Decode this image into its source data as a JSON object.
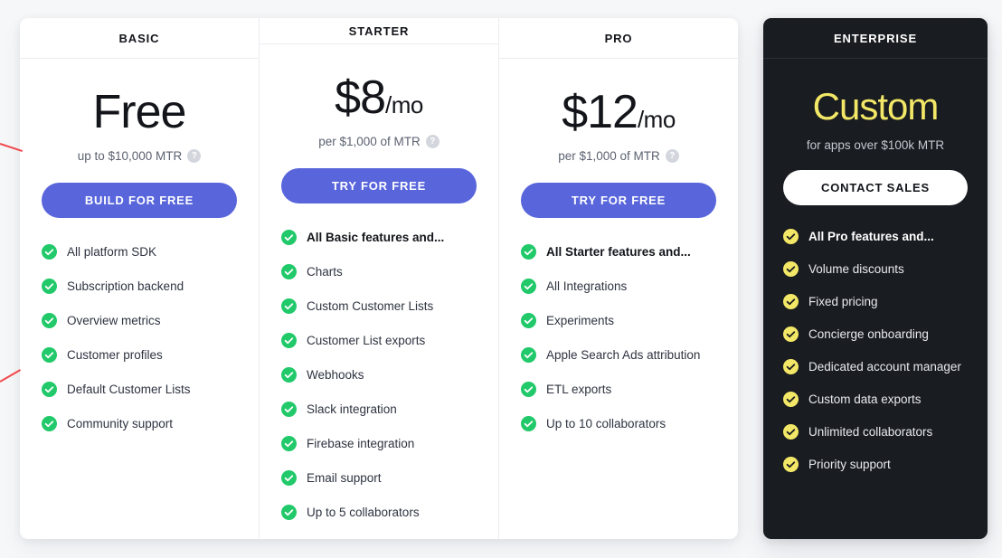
{
  "plans": [
    {
      "name": "BASIC",
      "price_main": "Free",
      "price_suffix": "",
      "price_note": "up to $10,000 MTR",
      "help_icon": "question-mark-icon",
      "help_label": "?",
      "cta_label": "BUILD FOR FREE",
      "theme": "light",
      "accent_color": "#5865db",
      "check_color": "#21c96a",
      "features": [
        {
          "label": "All platform SDK",
          "lead": false
        },
        {
          "label": "Subscription backend",
          "lead": false
        },
        {
          "label": "Overview metrics",
          "lead": false
        },
        {
          "label": "Customer profiles",
          "lead": false
        },
        {
          "label": "Default Customer Lists",
          "lead": false
        },
        {
          "label": "Community support",
          "lead": false
        }
      ]
    },
    {
      "name": "STARTER",
      "price_main": "$8",
      "price_suffix": "/mo",
      "price_note": "per $1,000 of MTR",
      "help_icon": "question-mark-icon",
      "help_label": "?",
      "cta_label": "TRY FOR FREE",
      "theme": "light",
      "accent_color": "#5865db",
      "check_color": "#21c96a",
      "features": [
        {
          "label": "All Basic features and...",
          "lead": true
        },
        {
          "label": "Charts",
          "lead": false
        },
        {
          "label": "Custom Customer Lists",
          "lead": false
        },
        {
          "label": "Customer List exports",
          "lead": false
        },
        {
          "label": "Webhooks",
          "lead": false
        },
        {
          "label": "Slack integration",
          "lead": false
        },
        {
          "label": "Firebase integration",
          "lead": false
        },
        {
          "label": "Email support",
          "lead": false
        },
        {
          "label": "Up to 5 collaborators",
          "lead": false
        }
      ]
    },
    {
      "name": "PRO",
      "price_main": "$12",
      "price_suffix": "/mo",
      "price_note": "per $1,000 of MTR",
      "help_icon": "question-mark-icon",
      "help_label": "?",
      "cta_label": "TRY FOR FREE",
      "theme": "light",
      "accent_color": "#5865db",
      "check_color": "#21c96a",
      "features": [
        {
          "label": "All Starter features and...",
          "lead": true
        },
        {
          "label": "All Integrations",
          "lead": false
        },
        {
          "label": "Experiments",
          "lead": false
        },
        {
          "label": "Apple Search Ads attribution",
          "lead": false
        },
        {
          "label": "ETL exports",
          "lead": false
        },
        {
          "label": "Up to 10 collaborators",
          "lead": false
        }
      ]
    }
  ],
  "enterprise": {
    "name": "ENTERPRISE",
    "price_main": "Custom",
    "price_suffix": "",
    "price_note": "for apps over $100k MTR",
    "cta_label": "CONTACT SALES",
    "theme": "dark",
    "accent_color": "#f3e767",
    "check_color": "#f3e767",
    "background_color": "#191c20",
    "features": [
      {
        "label": "All Pro features and...",
        "lead": true
      },
      {
        "label": "Volume discounts",
        "lead": false
      },
      {
        "label": "Fixed pricing",
        "lead": false
      },
      {
        "label": "Concierge onboarding",
        "lead": false
      },
      {
        "label": "Dedicated account manager",
        "lead": false
      },
      {
        "label": "Custom data exports",
        "lead": false
      },
      {
        "label": "Unlimited collaborators",
        "lead": false
      },
      {
        "label": "Priority support",
        "lead": false
      }
    ]
  },
  "page": {
    "background_color": "#f6f7f9",
    "annotation_color": "#f0474a"
  }
}
